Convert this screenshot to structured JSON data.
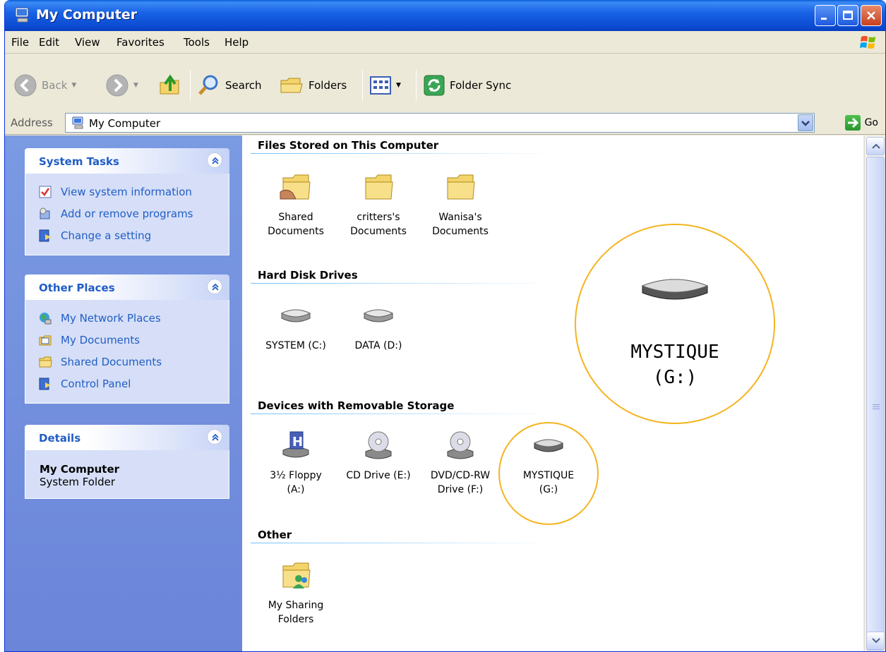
{
  "window": {
    "title": "My Computer"
  },
  "menu": [
    "File",
    "Edit",
    "View",
    "Favorites",
    "Tools",
    "Help"
  ],
  "toolbar": {
    "back": "Back",
    "search": "Search",
    "folders": "Folders",
    "folder_sync": "Folder Sync"
  },
  "address": {
    "label": "Address",
    "value": "My Computer",
    "go": "Go"
  },
  "sidebar": {
    "system_tasks": {
      "title": "System Tasks",
      "items": [
        "View system information",
        "Add or remove programs",
        "Change a setting"
      ]
    },
    "other_places": {
      "title": "Other Places",
      "items": [
        "My Network Places",
        "My Documents",
        "Shared Documents",
        "Control Panel"
      ]
    },
    "details": {
      "title": "Details",
      "name": "My Computer",
      "type": "System Folder"
    }
  },
  "groups": {
    "files": {
      "title": "Files Stored on This Computer",
      "items": [
        [
          "Shared",
          "Documents"
        ],
        [
          "critters's",
          "Documents"
        ],
        [
          "Wanisa's",
          "Documents"
        ]
      ]
    },
    "hard_disks": {
      "title": "Hard Disk Drives",
      "items": [
        "SYSTEM (C:)",
        "DATA (D:)"
      ]
    },
    "removable": {
      "title": "Devices with Removable Storage",
      "items": [
        [
          "3½ Floppy",
          "(A:)"
        ],
        [
          "CD Drive (E:)",
          ""
        ],
        [
          "DVD/CD-RW",
          "Drive (F:)"
        ],
        [
          "MYSTIQUE",
          "(G:)"
        ]
      ]
    },
    "other": {
      "title": "Other",
      "items": [
        [
          "My Sharing",
          "Folders"
        ]
      ]
    }
  },
  "callout": {
    "line1": "MYSTIQUE",
    "line2": "(G:)"
  },
  "colors": {
    "titlebar": "#0a5ed8",
    "highlight_circle": "#f5b41e",
    "task_link": "#215dc6"
  }
}
